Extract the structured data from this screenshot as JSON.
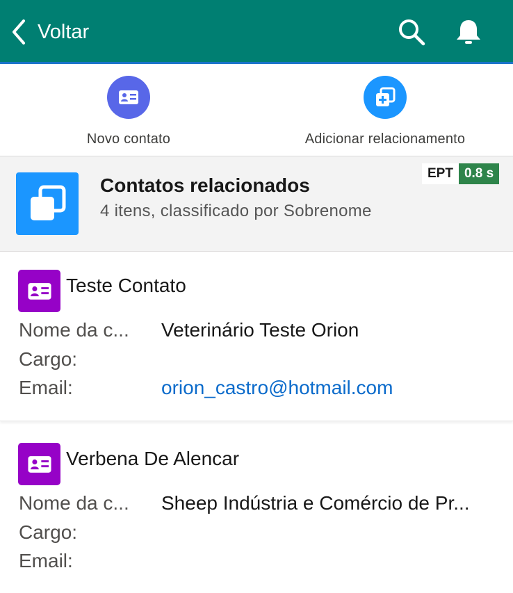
{
  "topbar": {
    "back_label": "Voltar",
    "icons": [
      "chevron-left-icon",
      "search-icon",
      "bell-icon"
    ]
  },
  "actions": [
    {
      "label": "Novo contato",
      "icon": "contact-card-icon",
      "color": "#5867e8"
    },
    {
      "label": "Adicionar relacionamento",
      "icon": "add-relationship-icon",
      "color": "#1b96ff"
    }
  ],
  "list_header": {
    "title": "Contatos relacionados",
    "subtitle": "4 itens, classificado por Sobrenome",
    "icon": "related-contacts-icon",
    "ept_label": "EPT",
    "ept_value": "0.8 s"
  },
  "contacts": [
    {
      "name": "Teste Contato",
      "fields": [
        {
          "label": "Nome da c...",
          "value": "Veterinário Teste Orion"
        },
        {
          "label": "Cargo:",
          "value": ""
        },
        {
          "label": "Email:",
          "value": "orion_castro@hotmail.com"
        }
      ]
    },
    {
      "name": "Verbena De Alencar",
      "fields": [
        {
          "label": "Nome da c...",
          "value": "Sheep Indústria e Comércio de Pr..."
        },
        {
          "label": "Cargo:",
          "value": ""
        },
        {
          "label": "Email:",
          "value": ""
        }
      ]
    }
  ],
  "colors": {
    "header_bar": "#007f72",
    "contact_icon": "#9602c7",
    "link": "#0b6bcb",
    "ept_badge": "#2e844a"
  }
}
